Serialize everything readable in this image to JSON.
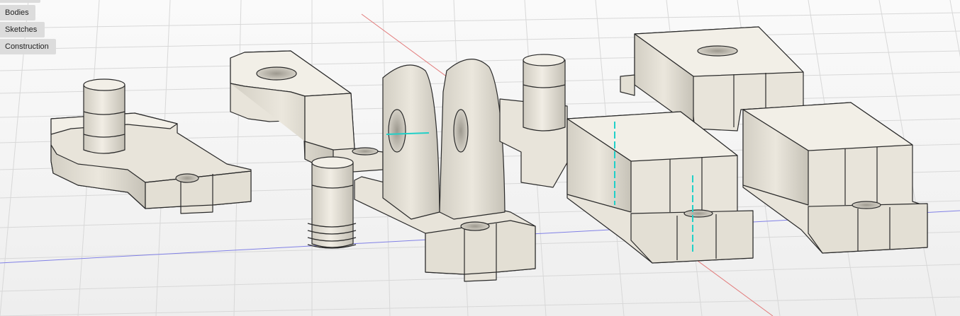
{
  "browser": {
    "items": [
      {
        "label": "Bodies"
      },
      {
        "label": "Sketches"
      },
      {
        "label": "Construction"
      }
    ]
  },
  "colors": {
    "background": "#f4f4f4",
    "grid_line": "#d6d6d6",
    "part_face": "#e8e4da",
    "part_top": "#f2efe7",
    "part_shade": "#c9c5bb",
    "edge": "#2a2a2a",
    "axis_x": "#e27a7a",
    "axis_y": "#7a7ae0",
    "sketch_line": "#20d0c8"
  },
  "icons": [
    "grid-plane-icon"
  ]
}
